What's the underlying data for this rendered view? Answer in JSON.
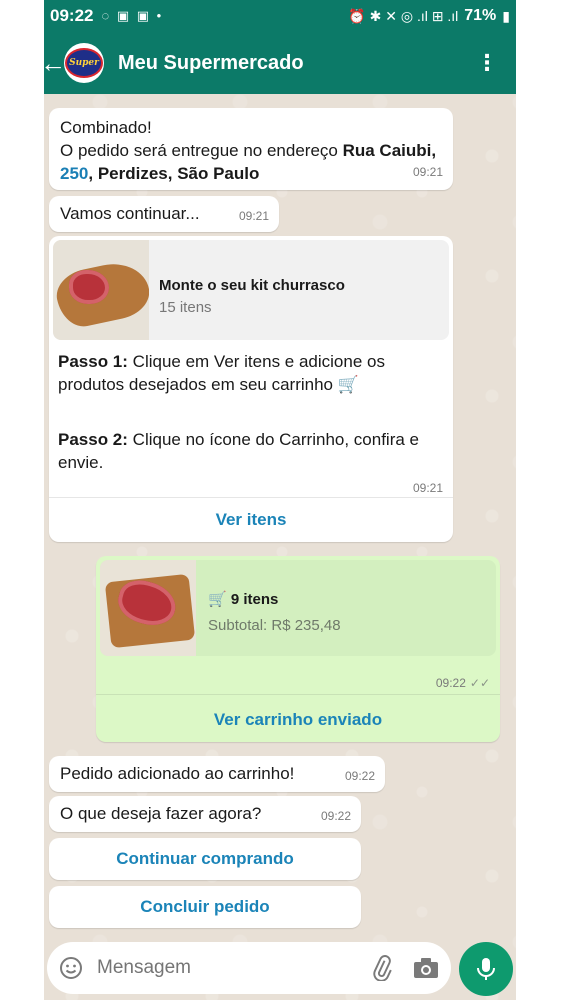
{
  "status_bar": {
    "time": "09:22",
    "left_icons": "◌ ▣ ▣ •",
    "right_icons": "⏰ ✱ ✕ ◎ .ıl ⊞ .ıl",
    "battery": "71%"
  },
  "app_bar": {
    "title": "Meu Supermercado",
    "avatar_text": "Super",
    "menu_glyph": "⋮",
    "back_glyph": "←"
  },
  "messages": {
    "m1": {
      "line1": "Combinado!",
      "line2_prefix": "O pedido será entregue no endereço ",
      "street": "Rua Caiubi",
      "comma1": ", ",
      "number": "250",
      "rest": ", Perdizes, São Paulo",
      "time": "09:21"
    },
    "m2": {
      "text": "Vamos continuar...",
      "time": "09:21"
    },
    "m3": {
      "card_title": "Monte o seu kit churrasco",
      "card_sub": "15 itens",
      "step1_label": "Passo 1:",
      "step1_text": " Clique em Ver itens e adicione os produtos desejados em seu carrinho 🛒",
      "step2_label": "Passo 2:",
      "step2_text": " Clique no ícone do Carrinho, confira e envie.",
      "time": "09:21",
      "button": "Ver itens"
    },
    "m4": {
      "items": "9 itens",
      "subtotal": "Subtotal: R$ 235,48",
      "time": "09:22",
      "ticks": "✓✓",
      "button": "Ver carrinho enviado"
    },
    "m5": {
      "text": "Pedido adicionado ao carrinho!",
      "time": "09:22"
    },
    "m6": {
      "text": "O que deseja fazer agora?",
      "time": "09:22"
    }
  },
  "quick_replies": {
    "continue": "Continuar comprando",
    "finish": "Concluir pedido"
  },
  "input": {
    "placeholder": "Mensagem"
  }
}
